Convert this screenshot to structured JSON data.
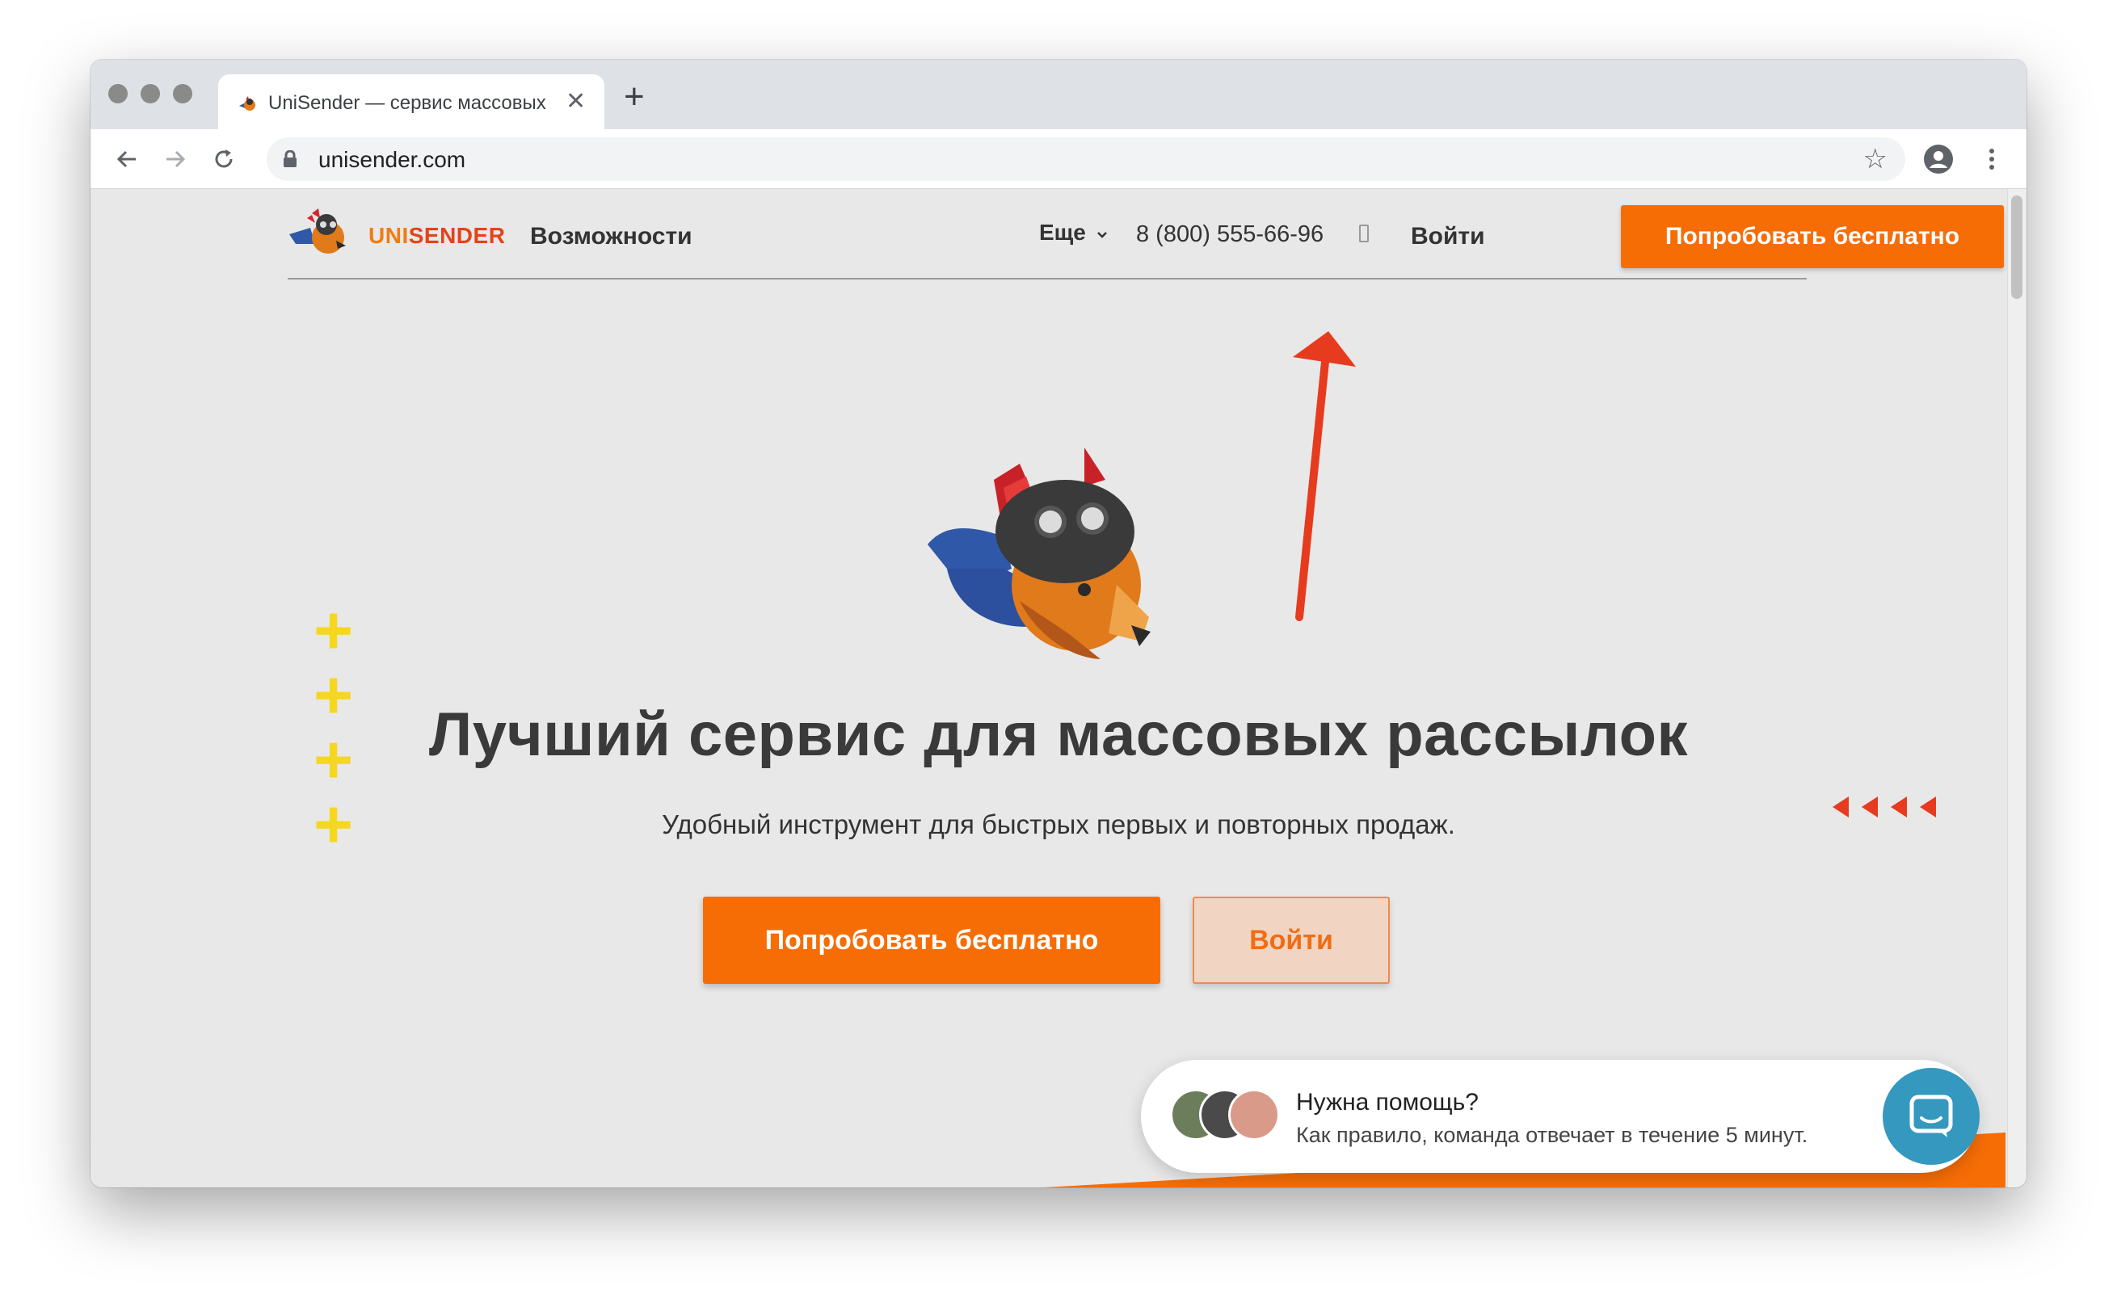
{
  "browser": {
    "tab_title": "UniSender — сервис массовых рассылок",
    "new_tab_symbol": "+",
    "close_symbol": "✕",
    "url": "unisender.com",
    "star_symbol": "☆"
  },
  "nav": {
    "logo_uni": "UNI",
    "logo_sender": "SENDER",
    "features": "Возможности",
    "more": "Еще",
    "phone": "8 (800) 555-66-96",
    "login": "Войти",
    "cta": "Попробовать бесплатно"
  },
  "hero": {
    "headline": "Лучший сервис для массовых рассылок",
    "subhead": "Удобный инструмент для быстрых первых и повторных продаж.",
    "cta_primary": "Попробовать бесплатно",
    "cta_secondary": "Войти"
  },
  "decor": {
    "plus_symbol": "+"
  },
  "chat": {
    "title": "Нужна помощь?",
    "subtitle": "Как правило, команда отвечает в течение 5 минут."
  },
  "colors": {
    "accent_orange": "#f66d06",
    "annotation_red": "#e63b1e",
    "chat_blue": "#3498bf",
    "decor_yellow": "#f5d71f"
  }
}
